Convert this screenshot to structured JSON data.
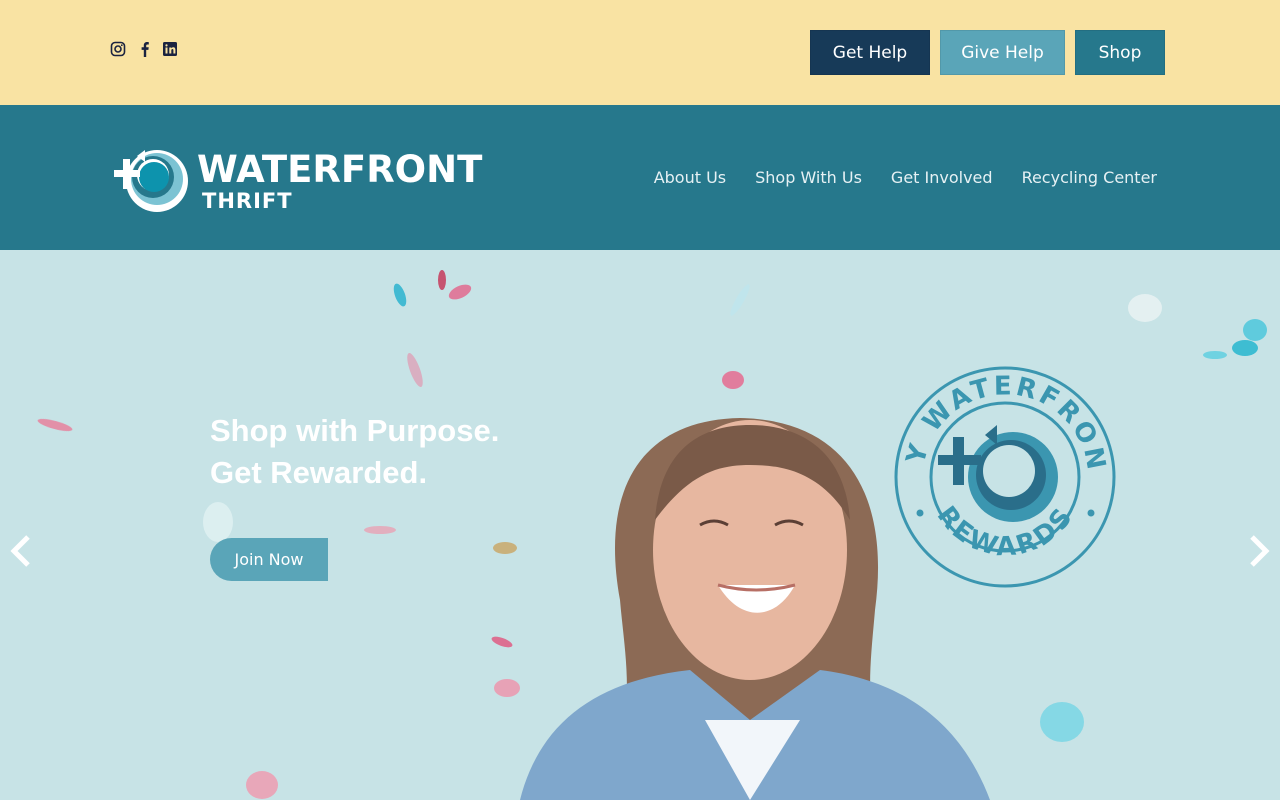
{
  "topbar": {
    "social": [
      {
        "icon": "instagram-icon"
      },
      {
        "icon": "facebook-icon"
      },
      {
        "icon": "linkedin-icon"
      }
    ],
    "buttons": {
      "get_help": "Get Help",
      "give_help": "Give Help",
      "shop": "Shop"
    }
  },
  "header": {
    "logo_title": "WATERFRONT",
    "logo_subtitle": "THRIFT",
    "nav": [
      "About Us",
      "Shop With Us",
      "Get Involved",
      "Recycling Center"
    ]
  },
  "hero": {
    "headline_line1": "Shop with Purpose.",
    "headline_line2": "Get Rewarded.",
    "cta": "Join Now",
    "badge_top": "MY WATERFRONT",
    "badge_bottom": "REWARDS",
    "prev_icon": "chevron-left-icon",
    "next_icon": "chevron-right-icon"
  },
  "colors": {
    "topbar_bg": "#f9e3a3",
    "header_bg": "#26788c",
    "get_help_bg": "#173a58",
    "give_help_bg": "#5aa5b8",
    "shop_bg": "#26788c",
    "hero_bg": "#c7e3e6"
  }
}
